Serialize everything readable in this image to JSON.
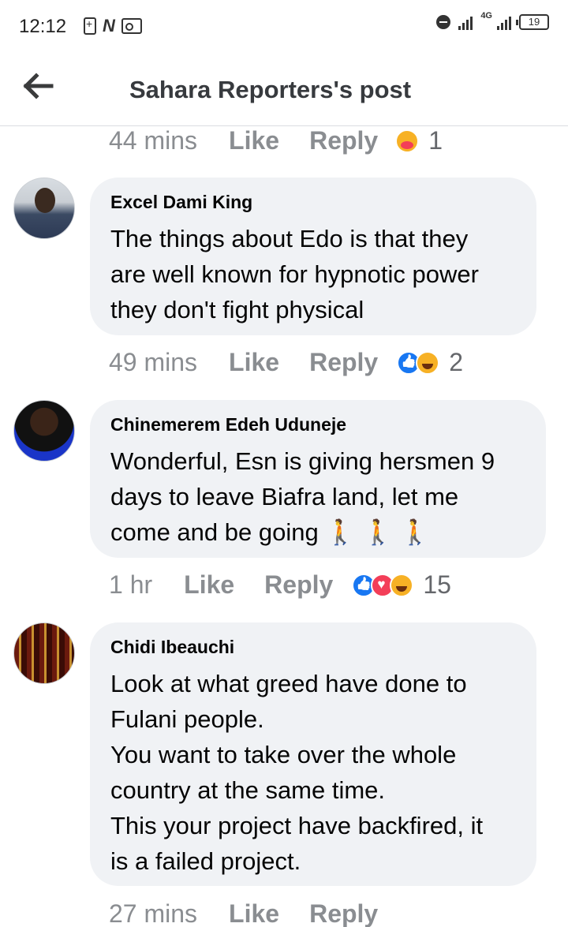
{
  "status_bar": {
    "time": "12:12",
    "network": "4G",
    "battery": "19",
    "icons": [
      "battery-saver-icon",
      "n-app-icon",
      "id-card-icon",
      "dnd-icon",
      "signal-icon"
    ]
  },
  "header": {
    "title": "Sahara Reporters's post",
    "back_icon": "arrow-left-icon"
  },
  "top_meta": {
    "time": "44 mins",
    "like": "Like",
    "reply": "Reply",
    "reactions": [
      "care"
    ],
    "count": "1"
  },
  "comments": [
    {
      "author": "Excel Dami King",
      "text": "The things about Edo is that they\nare well known for hypnotic power\nthey don't fight physical",
      "time": "49 mins",
      "like": "Like",
      "reply": "Reply",
      "reactions": [
        "like",
        "haha"
      ],
      "count": "2"
    },
    {
      "author": "Chinemerem Edeh Uduneje",
      "text": "Wonderful, Esn is giving hersmen 9\ndays to leave Biafra land, let me\ncome and be going 🚶 🚶 🚶",
      "time": "1 hr",
      "like": "Like",
      "reply": "Reply",
      "reactions": [
        "like",
        "love",
        "haha"
      ],
      "count": "15"
    },
    {
      "author": "Chidi Ibeauchi",
      "text": "Look at what greed have done to\nFulani people.\nYou want to take over the whole\ncountry at the same time.\nThis your project have backfired, it\nis a failed project.",
      "time": "27 mins",
      "like": "Like",
      "reply": "Reply",
      "reactions": [],
      "count": ""
    }
  ],
  "colors": {
    "bubble": "#f0f2f5",
    "meta_text": "#8a8d91",
    "like_blue": "#1877f2",
    "love_red": "#f33e58",
    "haha_yellow": "#f7b125"
  }
}
